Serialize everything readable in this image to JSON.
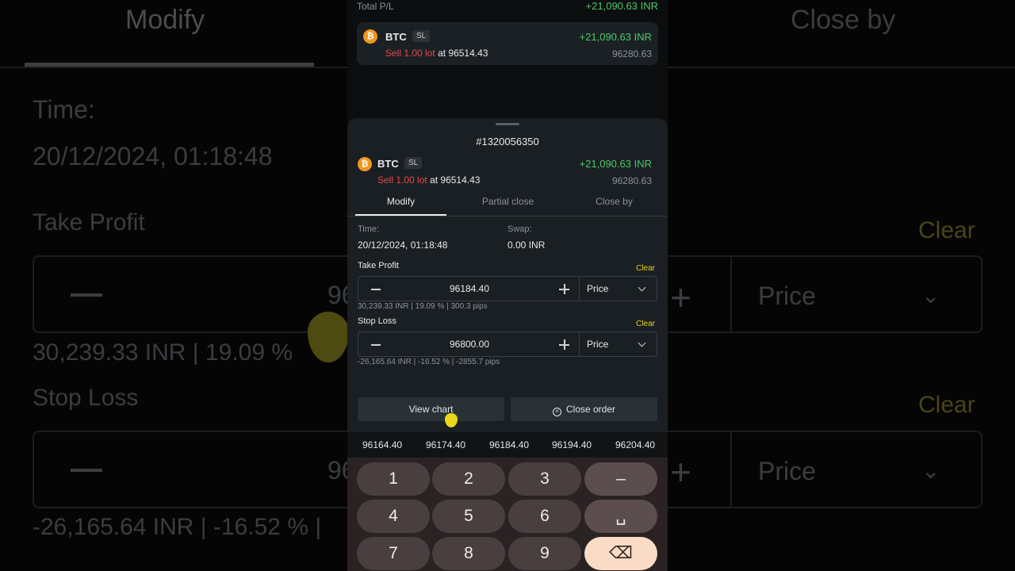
{
  "background": {
    "tab_modify": "Modify",
    "tab_close_by": "Close by",
    "time_label": "Time:",
    "time_value": "20/12/2024, 01:18:48",
    "take_profit": "Take Profit",
    "clear": "Clear",
    "price": "Price",
    "tp_stats": "30,239.33 INR | 19.09 %",
    "stop_loss": "Stop Loss",
    "sl_stats": "-26,165.64 INR | -16.52 % |",
    "value_fragment": "96"
  },
  "top": {
    "total_pl_label": "Total P/L",
    "total_pl_value": "+21,090.63 INR",
    "position": {
      "symbol": "BTC",
      "coin_glyph": "₿",
      "tag": "SL",
      "pl": "+21,090.63 INR",
      "side": "Sell 1.00 lot",
      "at": "at 96514.43",
      "current": "96280.63"
    }
  },
  "sheet": {
    "order_id": "#1320056350",
    "position": {
      "symbol": "BTC",
      "coin_glyph": "₿",
      "tag": "SL",
      "pl": "+21,090.63 INR",
      "side": "Sell 1.00 lot",
      "at": "at 96514.43",
      "current": "96280.63"
    },
    "tabs": [
      "Modify",
      "Partial close",
      "Close by"
    ],
    "time_label": "Time:",
    "time_value": "20/12/2024, 01:18:48",
    "swap_label": "Swap:",
    "swap_value": "0.00 INR",
    "take_profit": {
      "label": "Take Profit",
      "clear": "Clear",
      "value": "96184.40",
      "mode": "Price",
      "stats": "30,239.33 INR | 19.09 % | 300.3 pips"
    },
    "stop_loss": {
      "label": "Stop Loss",
      "clear": "Clear",
      "value": "96800.00",
      "mode": "Price",
      "stats": "-26,165.64 INR | -16.52 % | -2855.7 pips"
    },
    "view_chart": "View chart",
    "close_order": "Close order"
  },
  "suggestions": [
    "96164.40",
    "96174.40",
    "96184.40",
    "96194.40",
    "96204.40"
  ],
  "keyboard": {
    "row1": [
      "1",
      "2",
      "3",
      "–"
    ],
    "row2": [
      "4",
      "5",
      "6",
      "␣"
    ],
    "row3": [
      "7",
      "8",
      "9",
      "⌫"
    ]
  },
  "colors": {
    "profit": "#4cc769",
    "sell": "#e04a4a",
    "clear": "#e8d21c",
    "coin": "#f0961c"
  }
}
